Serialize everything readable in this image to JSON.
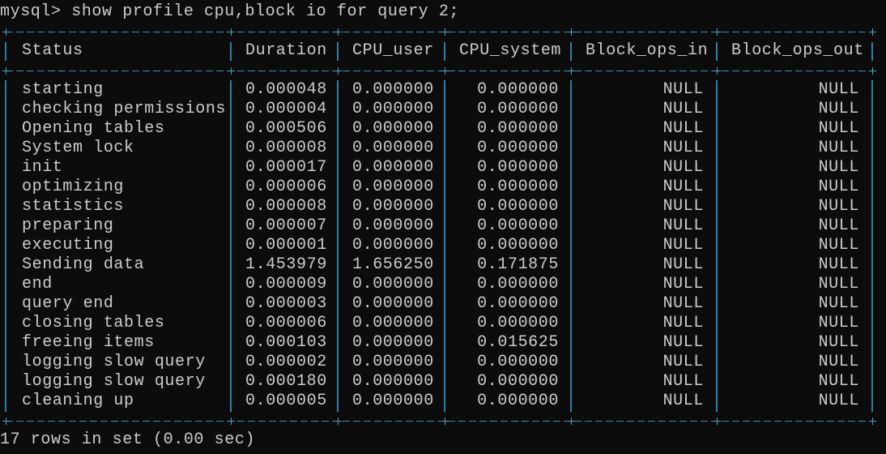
{
  "terminal": {
    "command_line": "mysql> show profile cpu,block io for query 2;",
    "footer": "17 rows in set (0.00 sec)",
    "colors": {
      "background": "#0c0c0c",
      "text": "#cccccc",
      "border": "#2c7fa0"
    }
  },
  "table": {
    "headers": [
      "Status",
      "Duration",
      "CPU_user",
      "CPU_system",
      "Block_ops_in",
      "Block_ops_out"
    ],
    "rows": [
      [
        "starting",
        "0.000048",
        "0.000000",
        "0.000000",
        "NULL",
        "NULL"
      ],
      [
        "checking permissions",
        "0.000004",
        "0.000000",
        "0.000000",
        "NULL",
        "NULL"
      ],
      [
        "Opening tables",
        "0.000506",
        "0.000000",
        "0.000000",
        "NULL",
        "NULL"
      ],
      [
        "System lock",
        "0.000008",
        "0.000000",
        "0.000000",
        "NULL",
        "NULL"
      ],
      [
        "init",
        "0.000017",
        "0.000000",
        "0.000000",
        "NULL",
        "NULL"
      ],
      [
        "optimizing",
        "0.000006",
        "0.000000",
        "0.000000",
        "NULL",
        "NULL"
      ],
      [
        "statistics",
        "0.000008",
        "0.000000",
        "0.000000",
        "NULL",
        "NULL"
      ],
      [
        "preparing",
        "0.000007",
        "0.000000",
        "0.000000",
        "NULL",
        "NULL"
      ],
      [
        "executing",
        "0.000001",
        "0.000000",
        "0.000000",
        "NULL",
        "NULL"
      ],
      [
        "Sending data",
        "1.453979",
        "1.656250",
        "0.171875",
        "NULL",
        "NULL"
      ],
      [
        "end",
        "0.000009",
        "0.000000",
        "0.000000",
        "NULL",
        "NULL"
      ],
      [
        "query end",
        "0.000003",
        "0.000000",
        "0.000000",
        "NULL",
        "NULL"
      ],
      [
        "closing tables",
        "0.000006",
        "0.000000",
        "0.000000",
        "NULL",
        "NULL"
      ],
      [
        "freeing items",
        "0.000103",
        "0.000000",
        "0.015625",
        "NULL",
        "NULL"
      ],
      [
        "logging slow query",
        "0.000002",
        "0.000000",
        "0.000000",
        "NULL",
        "NULL"
      ],
      [
        "logging slow query",
        "0.000180",
        "0.000000",
        "0.000000",
        "NULL",
        "NULL"
      ],
      [
        "cleaning up",
        "0.000005",
        "0.000000",
        "0.000000",
        "NULL",
        "NULL"
      ]
    ]
  }
}
